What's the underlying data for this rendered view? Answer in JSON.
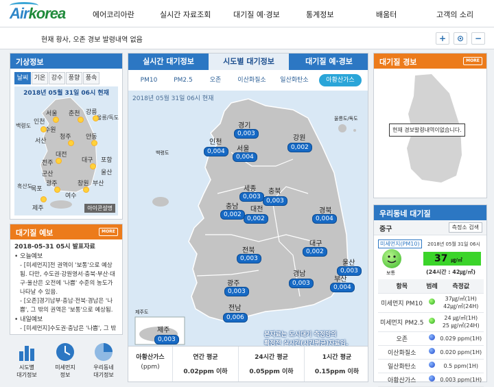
{
  "brand": {
    "logo_a": "Air",
    "logo_b": "korea"
  },
  "nav": [
    "에어코리아란",
    "실시간 자료조회",
    "대기질 예·경보",
    "통계정보",
    "배움터",
    "고객의 소리"
  ],
  "subbar": {
    "notice": "현재 황사, 오존 경보 발령내역 없음",
    "controls": [
      "+",
      "⊙",
      "−"
    ]
  },
  "weather": {
    "title": "기상정보",
    "tabs": [
      "날씨",
      "기온",
      "강수",
      "풍향",
      "풍속"
    ],
    "datetime": "2018년 05월 31일 06시 현재",
    "legend_button": "아이콘설명",
    "cities": [
      "서울",
      "춘천",
      "강릉",
      "울릉/독도",
      "백령도",
      "인천",
      "수원",
      "청주",
      "안동",
      "서산",
      "대전",
      "포항",
      "전주",
      "대구",
      "울산",
      "군산",
      "광주",
      "부산",
      "목포",
      "창원",
      "여수",
      "흑산도",
      "제주"
    ]
  },
  "forecast": {
    "title": "대기질 예보",
    "more": "MORE",
    "issued": "2018-05-31 05시 발표자료",
    "today": "오늘예보",
    "today_item1": "[미세먼지]전 권역이 '보통'으로 예상됨. 다만, 수도권·강원영서·충북·부산·대구·울산은 오전에 '나쁨' 수준의 농도가 나타날 수 있음.",
    "today_item2": "[오존]경기남부·충남·전북·경남은 '나쁨', 그 밖의 권역은 '보통'으로 예상됨.",
    "tomorrow": "내일예보",
    "tomorrow_item1": "[미세먼지]수도권·충남은 '나쁨', 그 밖"
  },
  "quicklinks": [
    {
      "label1": "시도별",
      "label2": "대기정보"
    },
    {
      "label1": "미세먼지",
      "label2": "정보"
    },
    {
      "label1": "우리동네",
      "label2": "대기정보"
    }
  ],
  "center": {
    "tabs": [
      "실시간 대기정보",
      "시도별 대기정보",
      "대기질 예·경보"
    ],
    "subtabs": [
      "PM10",
      "PM2.5",
      "오존",
      "이산화질소",
      "일산화탄소",
      "아황산가스"
    ],
    "datetime": "2018년 05월 31일 06시 현재",
    "regions": [
      {
        "name": "경기",
        "value": "0,003"
      },
      {
        "name": "강원",
        "value": "0,002"
      },
      {
        "name": "인천",
        "value": "0,004"
      },
      {
        "name": "서울",
        "value": "0,004"
      },
      {
        "name": "백령도",
        "value": ""
      },
      {
        "name": "울릉도/독도",
        "value": ""
      },
      {
        "name": "세종",
        "value": "0,003"
      },
      {
        "name": "충북",
        "value": "0,003"
      },
      {
        "name": "충남",
        "value": "0,002"
      },
      {
        "name": "대전",
        "value": "0,002"
      },
      {
        "name": "경북",
        "value": "0,004"
      },
      {
        "name": "전북",
        "value": "0,003"
      },
      {
        "name": "대구",
        "value": "0,002"
      },
      {
        "name": "울산",
        "value": "0,003"
      },
      {
        "name": "경남",
        "value": "0,003"
      },
      {
        "name": "광주",
        "value": "0,003"
      },
      {
        "name": "부산",
        "value": "0,004"
      },
      {
        "name": "전남",
        "value": "0,006"
      },
      {
        "name": "제주",
        "value": "0,003"
      }
    ],
    "jeju_label": "제주도",
    "note_line1": "본자료는 도시대기 측정망의",
    "note_line2": "확정전 실시간(시간평균)자료임.",
    "footer": {
      "pollutant": "아황산가스",
      "unit": "(ppm)",
      "cols": [
        {
          "t": "연간 평균",
          "v": "0.02ppm 이하"
        },
        {
          "t": "24시간 평균",
          "v": "0.05ppm 이하"
        },
        {
          "t": "1시간 평균",
          "v": "0.15ppm 이하"
        }
      ]
    }
  },
  "alert": {
    "title": "대기질 경보",
    "more": "MORE",
    "message": "현재 경보발령내역이없습니다."
  },
  "local": {
    "title": "우리동네 대기질",
    "district": "중구",
    "station_button": "측정소 검색",
    "pm_label": "미세먼지(PM10)",
    "datetime": "2018년 05월 31일 06시",
    "value": "37",
    "unit": "㎍/㎥",
    "status": "보통",
    "avg24": "(24시간 : 42㎍/㎥)",
    "table_head": [
      "항목",
      "범례",
      "측정값"
    ],
    "rows": [
      {
        "item": "미세먼지 PM10",
        "legend": "good",
        "value": "37㎍/㎥(1H)",
        "value2": "42㎍/㎥(24H)"
      },
      {
        "item": "미세먼지 PM2.5",
        "legend": "good",
        "value": "24 ㎍/㎥(1H)",
        "value2": "25 ㎍/㎥(24H)"
      },
      {
        "item": "오존",
        "legend": "blue",
        "value": "0.029 ppm(1H)"
      },
      {
        "item": "이산화질소",
        "legend": "blue",
        "value": "0.020 ppm(1H)"
      },
      {
        "item": "일산화탄소",
        "legend": "blue",
        "value": "0.5 ppm(1H)"
      },
      {
        "item": "아황산가스",
        "legend": "blue",
        "value": "0.003 ppm(1H)"
      }
    ]
  },
  "colors": {
    "accent": "#2c77c3",
    "orange": "#ec7b1b",
    "good": "#2aa51a",
    "very_good": "#1f46c9"
  }
}
